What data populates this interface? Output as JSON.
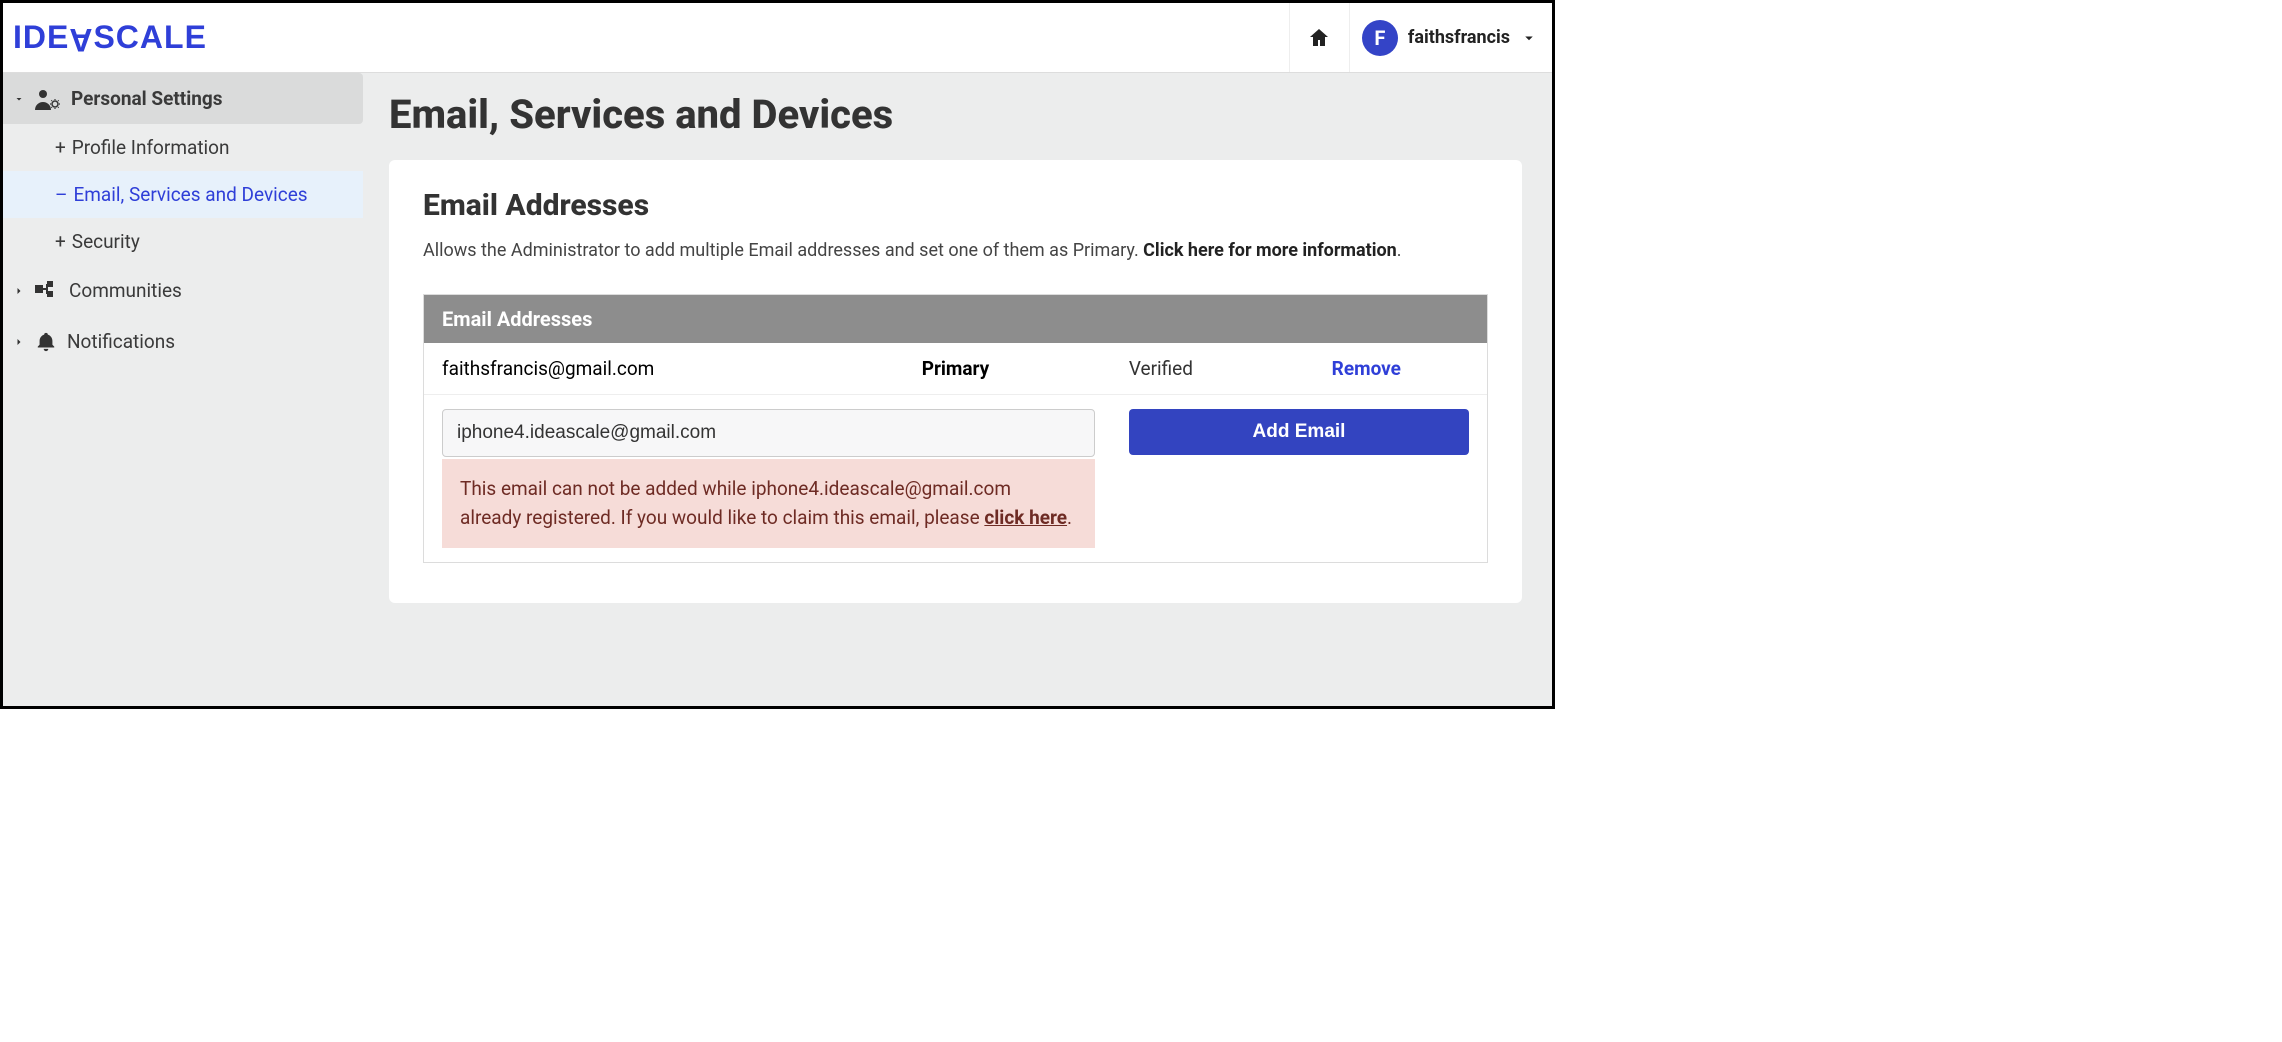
{
  "brand": {
    "name": "IDEASCALE"
  },
  "user": {
    "initial": "F",
    "name": "faithsfrancis"
  },
  "sidebar": {
    "personal": {
      "label": "Personal Settings",
      "items": [
        {
          "label": "Profile Information"
        },
        {
          "label": "Email, Services and Devices"
        },
        {
          "label": "Security"
        }
      ]
    },
    "communities": {
      "label": "Communities"
    },
    "notifications": {
      "label": "Notifications"
    }
  },
  "page": {
    "title": "Email, Services and Devices",
    "section_title": "Email Addresses",
    "desc_plain": "Allows the Administrator to add multiple Email addresses and set one of them as Primary. ",
    "desc_link": "Click here for more information",
    "table_title": "Email Addresses",
    "rows": [
      {
        "email": "faithsfrancis@gmail.com",
        "role": "Primary",
        "status": "Verified",
        "action": "Remove"
      }
    ],
    "input_value": "iphone4.ideascale@gmail.com",
    "add_label": "Add Email",
    "error_pre": "This email can not be added while iphone4.ideascale@gmail.com already registered. If you would like to claim this email, please ",
    "error_link": "click here",
    "error_post": "."
  }
}
